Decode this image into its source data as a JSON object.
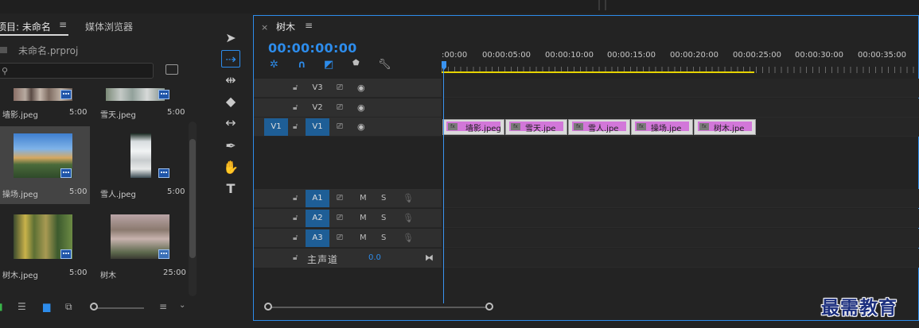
{
  "project_panel": {
    "tab_project": "项目: 未命名",
    "tab_menu": "≡",
    "tab_media": "媒体浏览器",
    "project_file": "未命名.prproj",
    "search_placeholder": "",
    "items": [
      {
        "name": "墙影.jpeg",
        "duration": "5:00",
        "thumb": "building"
      },
      {
        "name": "雪天.jpeg",
        "duration": "5:00",
        "thumb": "snow"
      },
      {
        "name": "操场.jpeg",
        "duration": "5:00",
        "thumb": "field"
      },
      {
        "name": "雪人.jpeg",
        "duration": "5:00",
        "thumb": "snowman"
      },
      {
        "name": "树木.jpeg",
        "duration": "5:00",
        "thumb": "trees"
      },
      {
        "name": "树木",
        "duration": "25:00",
        "thumb": "sequence"
      }
    ]
  },
  "tools_panel": {
    "tools": [
      "selection-tool",
      "track-select-tool",
      "ripple-edit-tool",
      "razor-tool",
      "slip-tool",
      "pen-tool",
      "hand-tool",
      "type-tool"
    ]
  },
  "timeline": {
    "sequence_name": "树木",
    "menu": "≡",
    "close": "×",
    "timecode": "00:00:00:00",
    "ruler_labels": [
      ":00:00",
      "00:00:05:00",
      "00:00:10:00",
      "00:00:15:00",
      "00:00:20:00",
      "00:00:25:00",
      "00:00:30:00",
      "00:00:35:00"
    ],
    "source_patch": "V1",
    "video_tracks": [
      "V3",
      "V2",
      "V1"
    ],
    "audio_tracks": [
      "A1",
      "A2",
      "A3"
    ],
    "mute_label": "M",
    "solo_label": "S",
    "master": {
      "label": "主声道",
      "value": "0.0"
    },
    "clips": [
      {
        "name": "墙影.jpeg",
        "fx": "fx"
      },
      {
        "name": "雪天.jpe",
        "fx": "fx"
      },
      {
        "name": "雪人.jpe",
        "fx": "fx"
      },
      {
        "name": "操场.jpe",
        "fx": "fx"
      },
      {
        "name": "树木.jpe",
        "fx": "fx"
      }
    ]
  },
  "watermark": "最需教育",
  "colors": {
    "accent": "#2d8ceb",
    "clip": "#d277d9",
    "workarea": "#e6d300",
    "badge": "#1f55a8"
  }
}
